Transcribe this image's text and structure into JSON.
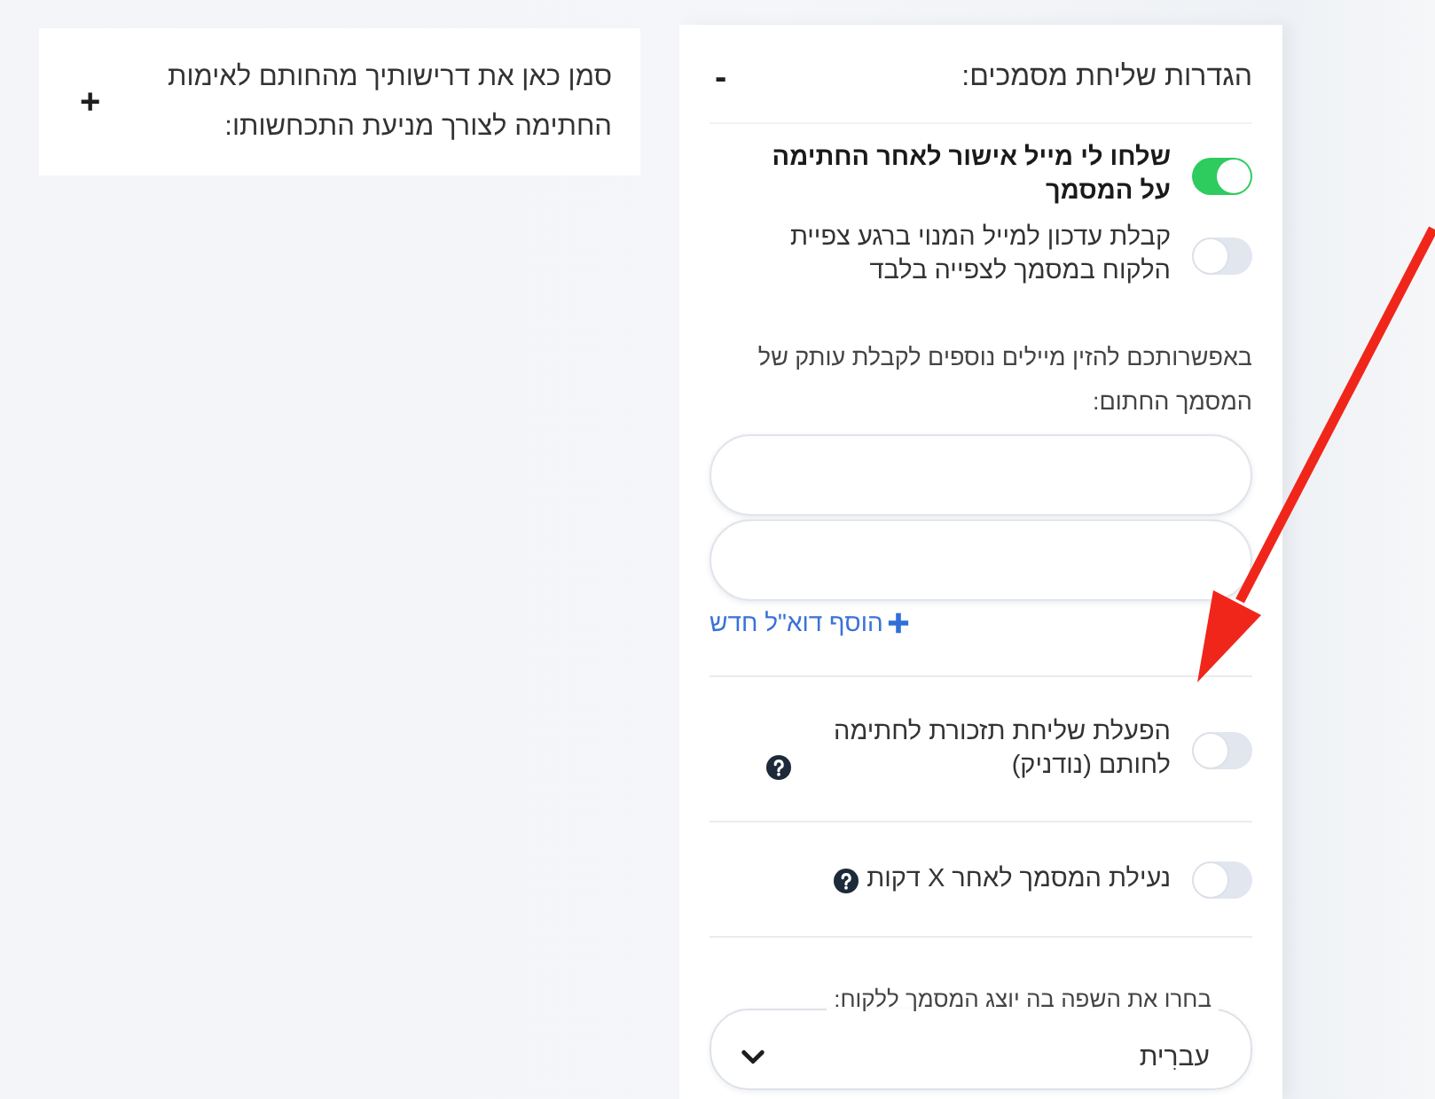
{
  "requirements_card": {
    "text": "סמן כאן את דרישותיך מהחותם לאימות החתימה לצורך מניעת התכחשותו:",
    "toggle_symbol": "+"
  },
  "settings_card": {
    "title": "הגדרות שליחת מסמכים:",
    "toggle_symbol": "-",
    "notifications": [
      {
        "label": "שלחו לי מייל אישור לאחר החתימה על המסמך",
        "on": true,
        "bold": true
      },
      {
        "label": "קבלת עדכון למייל המנוי ברגע צפיית הלקוח במסמך לצפייה בלבד",
        "on": false,
        "bold": false
      }
    ],
    "extra_emails": {
      "note": "באפשרותכם להזין מיילים נוספים לקבלת עותק של המסמך החתום:",
      "fields": [
        {
          "kind": "email"
        },
        {
          "kind": "email"
        }
      ],
      "add_link": "הוסף דוא\"ל חדש"
    },
    "options": [
      {
        "label": "הפעלת שליחת תזכורת לחתימה לחותם (נודניק)",
        "on": false,
        "help": true
      },
      {
        "label": "נעילת המסמך לאחר X דקות",
        "on": false,
        "help": true
      }
    ],
    "language_select": {
      "label": "בחרו את השפה בה יוצג המסמך ללקוח:",
      "value": "עברִית"
    }
  }
}
